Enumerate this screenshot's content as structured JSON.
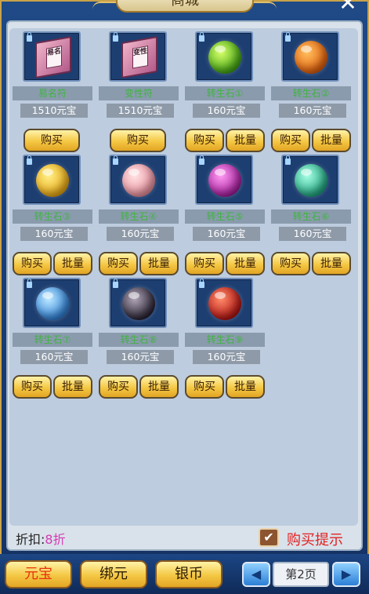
{
  "window": {
    "title": "商城",
    "close_label": "✕"
  },
  "items": [
    {
      "name": "易名符",
      "price": "1510元宝",
      "type": "book",
      "book_text": "易名",
      "buttons": [
        "buy"
      ],
      "colors": [
        "#f0b4c8",
        "#b25a8a"
      ]
    },
    {
      "name": "变性符",
      "price": "1510元宝",
      "type": "book",
      "book_text": "变性",
      "buttons": [
        "buy"
      ],
      "colors": [
        "#f0b4c8",
        "#b25a8a"
      ]
    },
    {
      "name": "转生石①",
      "price": "160元宝",
      "type": "orb",
      "buttons": [
        "buy",
        "bulk"
      ],
      "colors": [
        "#d7ff6a",
        "#3aa10e"
      ]
    },
    {
      "name": "转生石②",
      "price": "160元宝",
      "type": "orb",
      "buttons": [
        "buy",
        "bulk"
      ],
      "colors": [
        "#ffc160",
        "#e05a08"
      ]
    },
    {
      "name": "转生石③",
      "price": "160元宝",
      "type": "orb",
      "buttons": [
        "buy",
        "bulk"
      ],
      "colors": [
        "#fff08a",
        "#e7a40c"
      ]
    },
    {
      "name": "转生石④",
      "price": "160元宝",
      "type": "orb",
      "buttons": [
        "buy",
        "bulk"
      ],
      "colors": [
        "#ffe4e4",
        "#e88a98"
      ]
    },
    {
      "name": "转生石⑤",
      "price": "160元宝",
      "type": "orb",
      "buttons": [
        "buy",
        "bulk"
      ],
      "colors": [
        "#ff9cf2",
        "#a3189a"
      ]
    },
    {
      "name": "转生石⑥",
      "price": "160元宝",
      "type": "orb",
      "buttons": [
        "buy",
        "bulk"
      ],
      "colors": [
        "#a8ffe6",
        "#1aa27a"
      ]
    },
    {
      "name": "转生石⑦",
      "price": "160元宝",
      "type": "orb",
      "buttons": [
        "buy",
        "bulk"
      ],
      "colors": [
        "#bfeaff",
        "#2a7ed8"
      ]
    },
    {
      "name": "转生石⑧",
      "price": "160元宝",
      "type": "orb",
      "buttons": [
        "buy",
        "bulk"
      ],
      "colors": [
        "#b0a6b8",
        "#241e2e"
      ]
    },
    {
      "name": "转生石⑨",
      "price": "160元宝",
      "type": "orb",
      "buttons": [
        "buy",
        "bulk"
      ],
      "colors": [
        "#ff8c6a",
        "#b00f0f"
      ]
    }
  ],
  "labels": {
    "buy": "购买",
    "bulk": "批量"
  },
  "footer": {
    "discount_label": "折扣:",
    "discount_value": "8折",
    "tip_check": "✔",
    "tip_text": "购买提示"
  },
  "tabs": [
    {
      "label": "元宝",
      "active": true
    },
    {
      "label": "绑元",
      "active": false
    },
    {
      "label": "银币",
      "active": false
    }
  ],
  "pager": {
    "prev": "◀",
    "page": "第2页",
    "next": "▶"
  }
}
